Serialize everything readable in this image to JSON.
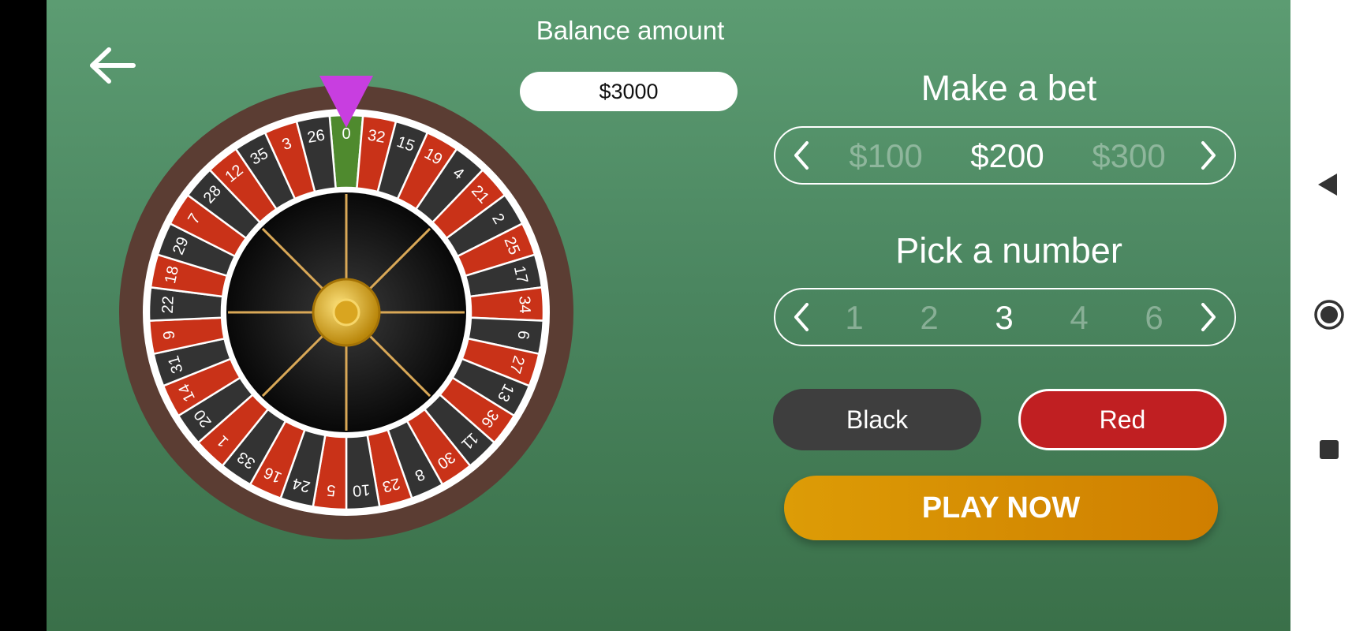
{
  "balance": {
    "label": "Balance amount",
    "value": "$3000"
  },
  "bet": {
    "title": "Make a bet",
    "options": [
      "$100",
      "$200",
      "$300"
    ],
    "selected_index": 1
  },
  "number": {
    "title": "Pick a number",
    "options": [
      "1",
      "2",
      "3",
      "4",
      "6"
    ],
    "selected_index": 2
  },
  "color_buttons": {
    "black": "Black",
    "red": "Red"
  },
  "play": {
    "label": "PLAY NOW"
  },
  "wheel": {
    "pointer_color": "#c83ee0",
    "numbers": [
      "0",
      "32",
      "15",
      "19",
      "4",
      "21",
      "2",
      "25",
      "17",
      "34",
      "6",
      "27",
      "13",
      "36",
      "11",
      "30",
      "8",
      "23",
      "10",
      "5",
      "24",
      "16",
      "33",
      "1",
      "20",
      "14",
      "31",
      "9",
      "22",
      "18",
      "29",
      "7",
      "28",
      "12",
      "35",
      "3",
      "26"
    ],
    "colors": [
      "green",
      "red",
      "black",
      "red",
      "black",
      "red",
      "black",
      "red",
      "black",
      "red",
      "black",
      "red",
      "black",
      "red",
      "black",
      "red",
      "black",
      "red",
      "black",
      "red",
      "black",
      "red",
      "black",
      "red",
      "black",
      "red",
      "black",
      "red",
      "black",
      "red",
      "black",
      "red",
      "black",
      "red",
      "black",
      "red",
      "black"
    ]
  },
  "icons": {
    "back": "back-arrow-icon",
    "nav_back": "triangle-back-icon",
    "nav_home": "circle-home-icon",
    "nav_recents": "square-recents-icon"
  },
  "colors": {
    "table_green": "#4b8660",
    "play_gold": "#d48a02",
    "red": "#c01f22",
    "black": "#3e3e3e"
  }
}
